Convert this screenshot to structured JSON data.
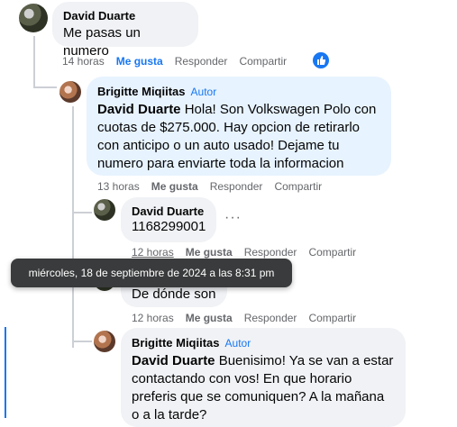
{
  "comments": [
    {
      "author": "David Duarte",
      "text": "Me pasas un numero",
      "time": "14 horas",
      "like": "Me gusta",
      "reply": "Responder",
      "share": "Compartir"
    },
    {
      "author": "Brigitte Miqiitas",
      "badge": "Autor",
      "mention": "David Duarte",
      "text": " Hola! Son Volkswagen Polo con cuotas de $275.000. Hay opcion de retirarlo con anticipo o un auto usado! Dejame tu numero para enviarte toda la informacion",
      "time": "13 horas",
      "like": "Me gusta",
      "reply": "Responder",
      "share": "Compartir"
    },
    {
      "author": "David Duarte",
      "text": "1168299001",
      "more": "···",
      "time": "12 horas",
      "like": "Me gusta",
      "reply": "Responder",
      "share": "Compartir"
    },
    {
      "text": "De dónde son",
      "time": "12 horas",
      "like": "Me gusta",
      "reply": "Responder",
      "share": "Compartir"
    },
    {
      "author": "Brigitte Miqiitas",
      "badge": "Autor",
      "mention": "David Duarte",
      "text": " Buenisimo! Ya se van a estar contactando con vos! En que horario preferis que se comuniquen? A la mañana o a la tarde?"
    }
  ],
  "tooltip": "miércoles, 18 de septiembre de 2024 a las 8:31 pm",
  "colors": {
    "accent": "#1877f2",
    "bubble": "#f0f2f5",
    "bubble_highlight": "#e7f3ff"
  },
  "icons": {
    "reaction": "like-reaction-icon"
  }
}
